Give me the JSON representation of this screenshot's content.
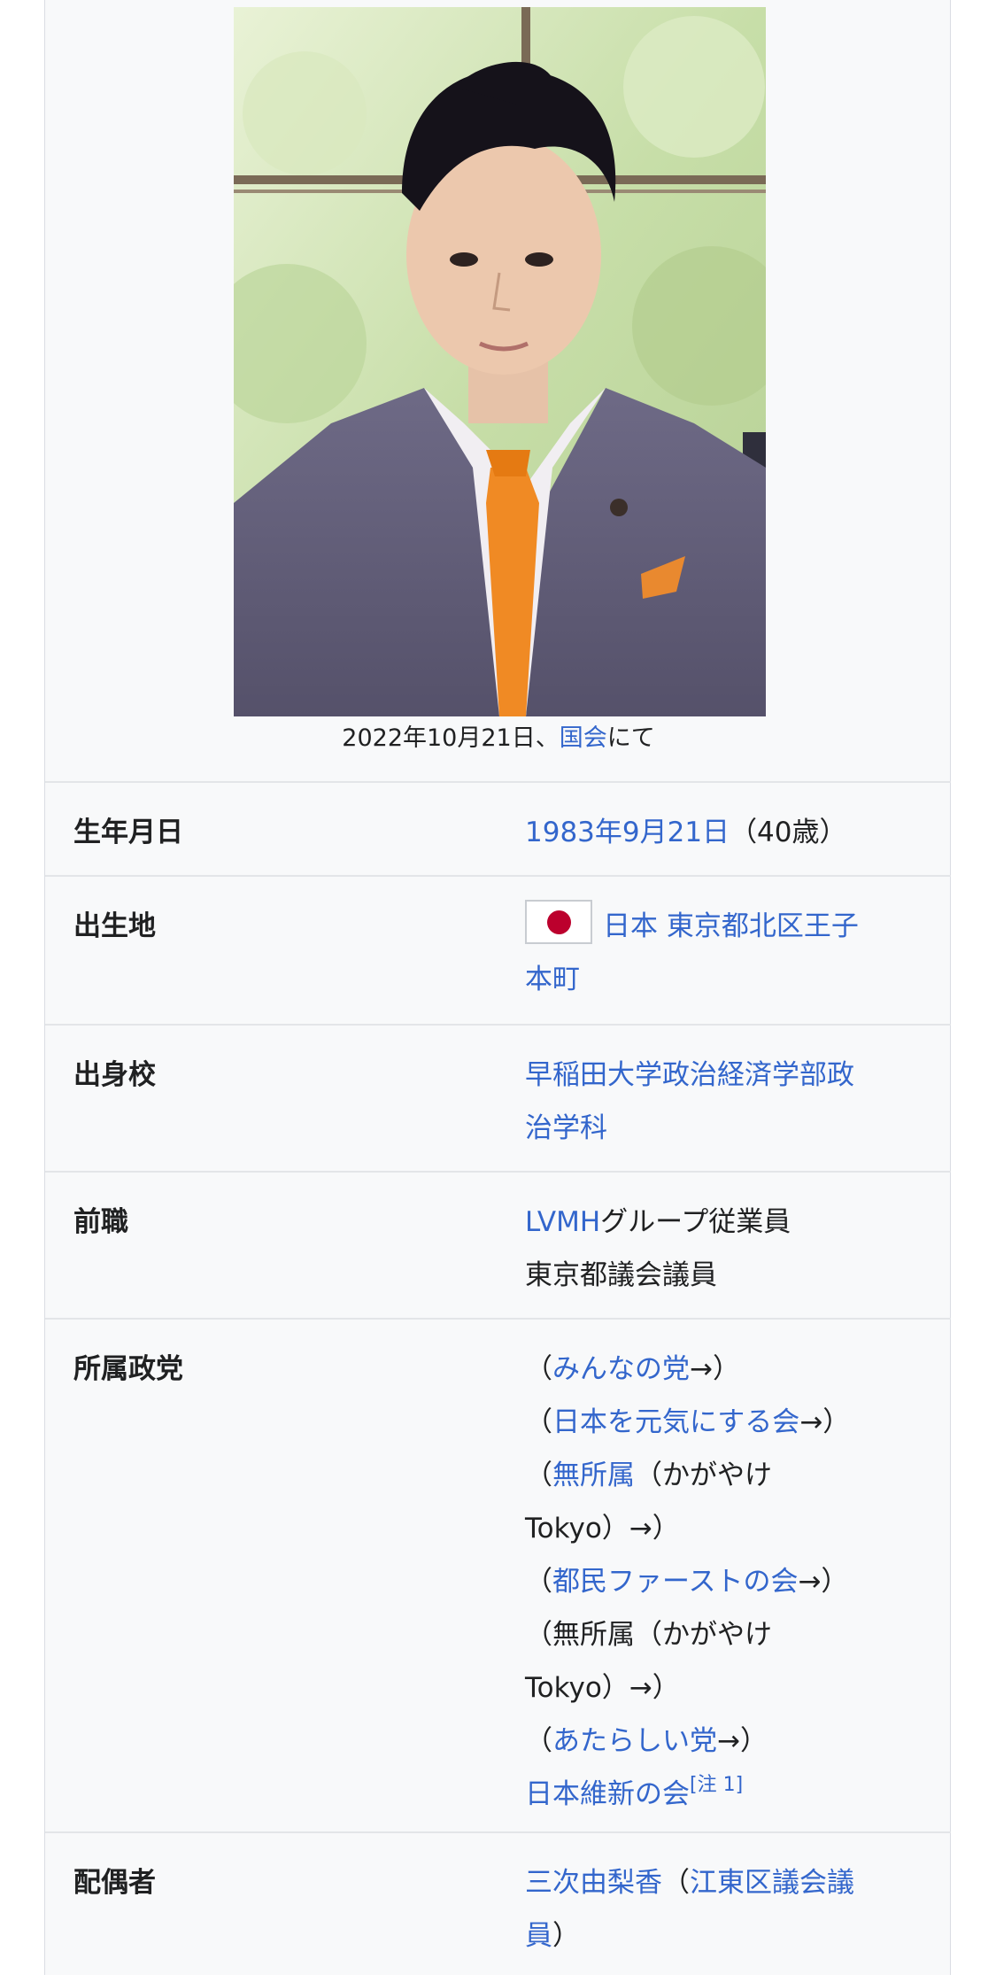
{
  "caption": {
    "date": "2022年10月21日、",
    "place_link": "国会",
    "suffix": "にて"
  },
  "rows": {
    "birth": {
      "label": "生年月日",
      "date_link": "1983年9月21日",
      "age": "（40歳）"
    },
    "birthplace": {
      "label": "出生地",
      "country_link": "日本",
      "place_link_line1": "東京都北区王子",
      "place_link_line2": "本町"
    },
    "school": {
      "label": "出身校",
      "link_line1": "早稲田大学政治経済学部政",
      "link_line2": "治学科"
    },
    "previous_job": {
      "label": "前職",
      "company_link": "LVMH",
      "company_suffix": "グループ従業員",
      "line2": "東京都議会議員"
    },
    "party": {
      "label": "所属政党",
      "open": "（",
      "arrow_close": "→）",
      "entries": [
        {
          "link": "みんなの党"
        },
        {
          "link": "日本を元気にする会"
        },
        {
          "link": "無所属",
          "rest_line1": "（かがやけ",
          "rest_line2": "Tokyo）"
        },
        {
          "link": "都民ファーストの会"
        },
        {
          "plain_line1": "無所属（かがやけ",
          "plain_line2": "Tokyo）"
        },
        {
          "link": "あたらしい党"
        }
      ],
      "current_link": "日本維新の会",
      "note": "[注 1]"
    },
    "spouse": {
      "label": "配偶者",
      "name_link": "三次由梨香",
      "paren_open": "（",
      "role_link_line1": "江東区議会議",
      "role_link_line2": "員",
      "paren_close": "）"
    }
  },
  "icons": {
    "flag": "japan-flag-icon"
  },
  "colors": {
    "link": "#3366cc",
    "infobox_bg": "#f8f9fa",
    "flag_red": "#bc002d"
  }
}
